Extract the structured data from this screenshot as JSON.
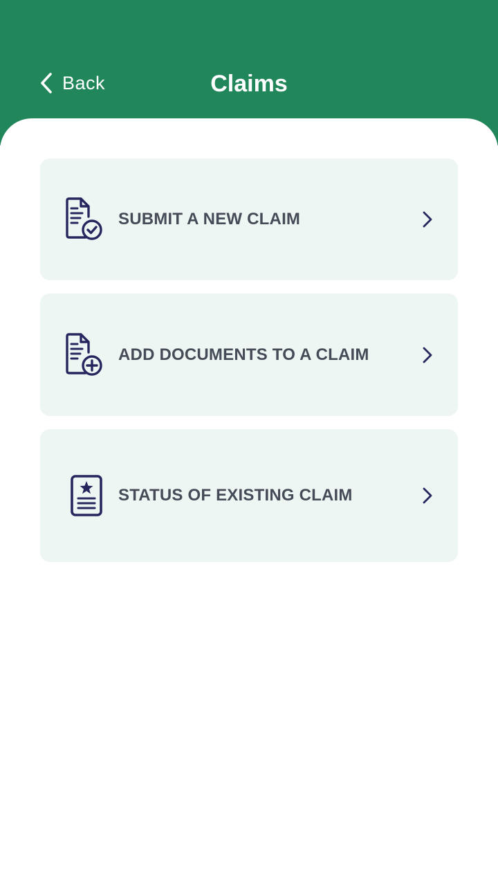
{
  "header": {
    "back_label": "Back",
    "title": "Claims"
  },
  "menu": [
    {
      "label": "SUBMIT A NEW CLAIM",
      "icon": "document-check-icon"
    },
    {
      "label": "ADD DOCUMENTS TO A CLAIM",
      "icon": "document-add-icon"
    },
    {
      "label": "STATUS OF EXISTING CLAIM",
      "icon": "document-star-icon"
    }
  ],
  "colors": {
    "header_bg": "#21875b",
    "card_bg": "#edf6f2",
    "icon": "#26275f",
    "label_text": "#464b58"
  }
}
